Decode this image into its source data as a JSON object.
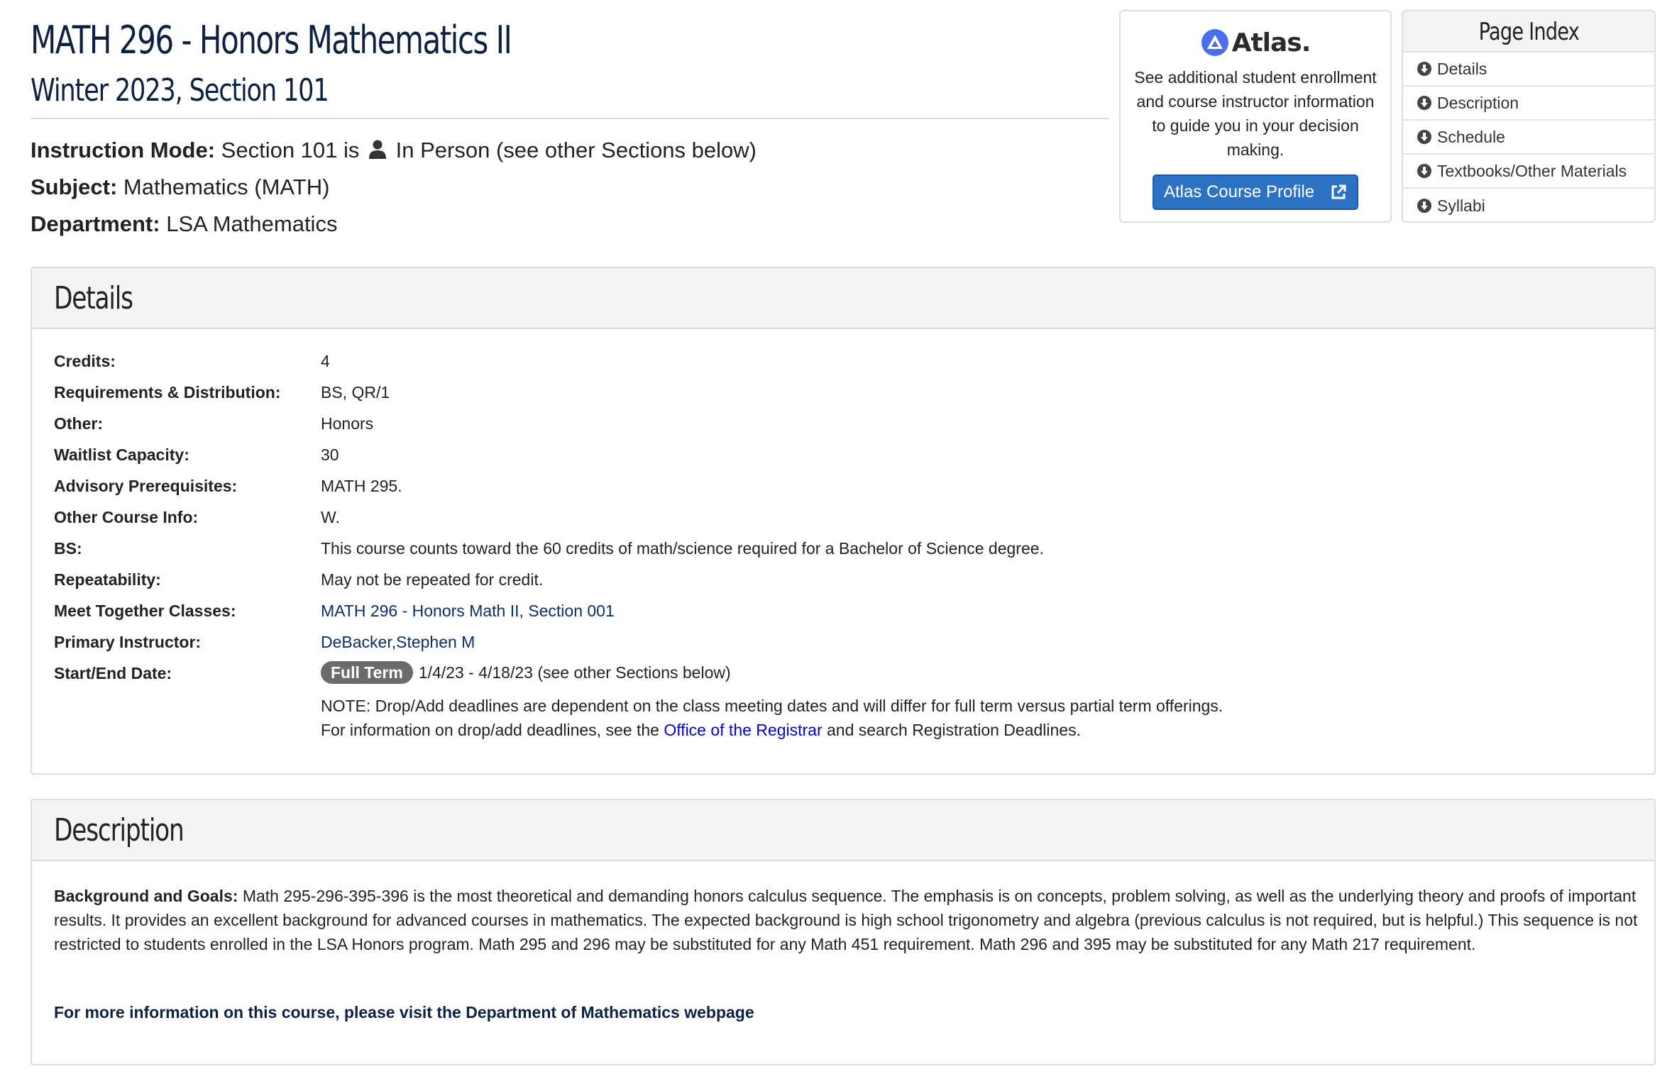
{
  "course": {
    "title": "MATH 296 - Honors Mathematics II",
    "subtitle": "Winter 2023, Section 101"
  },
  "meta": {
    "instruction_label": "Instruction Mode:",
    "instruction_pre": "Section 101 is",
    "instruction_post": "In Person (see other Sections below)",
    "subject_label": "Subject:",
    "subject_value": "Mathematics (MATH)",
    "department_label": "Department:",
    "department_value": "LSA Mathematics"
  },
  "atlas": {
    "logo_text": "Atlas.",
    "text": "See additional student enrollment and course instructor information to guide you in your decision making.",
    "button_label": "Atlas Course Profile"
  },
  "page_index": {
    "title": "Page Index",
    "items": [
      "Details",
      "Description",
      "Schedule",
      "Textbooks/Other Materials",
      "Syllabi"
    ]
  },
  "details": {
    "title": "Details",
    "rows": [
      {
        "label": "Credits:",
        "value": "4"
      },
      {
        "label": "Requirements & Distribution:",
        "value": "BS, QR/1"
      },
      {
        "label": "Other:",
        "value": "Honors"
      },
      {
        "label": "Waitlist Capacity:",
        "value": "30"
      },
      {
        "label": "Advisory Prerequisites:",
        "value": "MATH 295."
      },
      {
        "label": "Other Course Info:",
        "value": "W."
      },
      {
        "label": "BS:",
        "value": "This course counts toward the 60 credits of math/science required for a Bachelor of Science degree."
      },
      {
        "label": "Repeatability:",
        "value": "May not be repeated for credit."
      },
      {
        "label": "Meet Together Classes:",
        "value": "MATH 296 - Honors Math II, Section 001"
      },
      {
        "label": "Primary Instructor:",
        "value": "DeBacker,Stephen M"
      },
      {
        "label": "Start/End Date:",
        "value": "1/4/23 - 4/18/23 (see other Sections below)"
      }
    ],
    "term_badge": "Full Term",
    "note": "NOTE: Drop/Add deadlines are dependent on the class meeting dates and will differ for full term versus partial term offerings.",
    "info_pre": "For information on drop/add deadlines, see the",
    "info_link": "Office of the Registrar",
    "info_post": "and search Registration Deadlines."
  },
  "description": {
    "title": "Description",
    "bg_label": "Background and Goals:",
    "bg_text": "Math 295-296-395-396 is the most theoretical and demanding honors calculus sequence. The emphasis is on concepts, problem solving, as well as the underlying theory and proofs of important results. It provides an excellent background for advanced courses in mathematics. The expected background is high school trigonometry and algebra (previous calculus is not required, but is helpful.) This sequence is not restricted to students enrolled in the LSA Honors program. Math 295 and 296 may be substituted for any Math 451 requirement. Math 296 and 395 may be substituted for any Math 217 requirement.",
    "more_link": "For more information on this course, please visit the Department of Mathematics webpage"
  },
  "colors": {
    "heading": "#0d2143",
    "link": "#0d2d6b",
    "button": "#2e72c6",
    "badge": "#6b6b6b"
  },
  "icons": [
    "person-icon",
    "atlas-logo-icon",
    "external-link-icon",
    "arrow-circle-down-icon"
  ]
}
